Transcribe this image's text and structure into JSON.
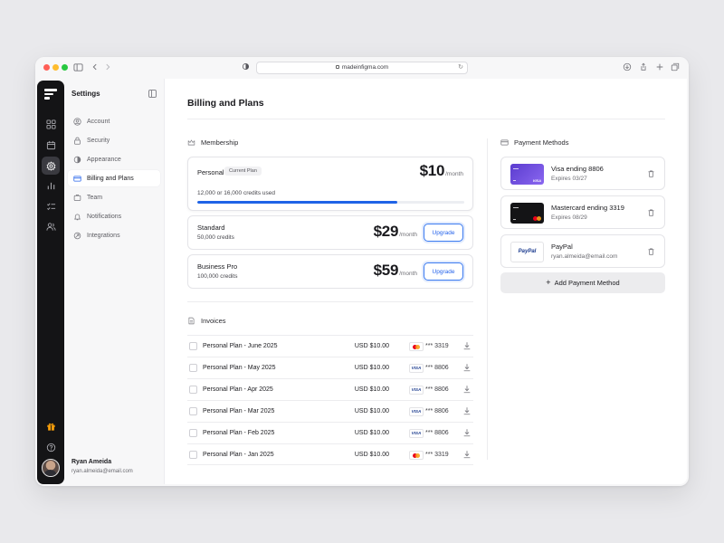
{
  "browser": {
    "url": "madeinfigma.com"
  },
  "colors": {
    "accent": "#1f63e6",
    "rail": "#141416",
    "visa_card": "#6b4ce0",
    "mastercard_card": "#141416"
  },
  "rail": {
    "icons": [
      "logo-icon",
      "grid-icon",
      "calendar-icon",
      "gear-icon",
      "chart-icon",
      "checklist-icon",
      "users-icon",
      "gift-icon",
      "help-icon"
    ],
    "active": "gear-icon"
  },
  "sidebar": {
    "title": "Settings",
    "items": [
      {
        "label": "Account",
        "icon": "user-icon"
      },
      {
        "label": "Security",
        "icon": "lock-icon"
      },
      {
        "label": "Appearance",
        "icon": "contrast-icon"
      },
      {
        "label": "Billing and Plans",
        "icon": "card-icon",
        "active": true
      },
      {
        "label": "Team",
        "icon": "team-icon"
      },
      {
        "label": "Notifications",
        "icon": "bell-icon"
      },
      {
        "label": "Integrations",
        "icon": "integration-icon"
      }
    ],
    "user": {
      "name": "Ryan Ameida",
      "email": "ryan.almeida@email.com"
    }
  },
  "main": {
    "title": "Billing and Plans",
    "membership": {
      "heading": "Membership",
      "plans": [
        {
          "name": "Personal",
          "badge": "Current Plan",
          "price": "$10",
          "period": "/month",
          "usage_text": "12,000 or 16,000 credits used",
          "usage_fraction": 0.75
        },
        {
          "name": "Standard",
          "credits": "50,000 credits",
          "price": "$29",
          "period": "/month",
          "button": "Upgrade"
        },
        {
          "name": "Business Pro",
          "credits": "100,000 credits",
          "price": "$59",
          "period": "/month",
          "button": "Upgrade"
        }
      ]
    },
    "invoices": {
      "heading": "Invoices",
      "rows": [
        {
          "description": "Personal Plan - June 2025",
          "amount": "USD $10.00",
          "brand": "mastercard",
          "card": "*** 3319"
        },
        {
          "description": "Personal Plan - May 2025",
          "amount": "USD $10.00",
          "brand": "visa",
          "brand_label": "VISA",
          "card": "*** 8806"
        },
        {
          "description": "Personal Plan - Apr 2025",
          "amount": "USD $10.00",
          "brand": "visa",
          "brand_label": "VISA",
          "card": "*** 8806"
        },
        {
          "description": "Personal Plan - Mar 2025",
          "amount": "USD $10.00",
          "brand": "visa",
          "brand_label": "VISA",
          "card": "*** 8806"
        },
        {
          "description": "Personal Plan - Feb 2025",
          "amount": "USD $10.00",
          "brand": "visa",
          "brand_label": "VISA",
          "card": "*** 8806"
        },
        {
          "description": "Personal Plan - Jan 2025",
          "amount": "USD $10.00",
          "brand": "mastercard",
          "card": "*** 3319"
        }
      ]
    },
    "payment_methods": {
      "heading": "Payment Methods",
      "methods": [
        {
          "title": "Visa ending 8806",
          "subtitle": "Expires 03/27",
          "kind": "visa",
          "thumb_label": "VISA"
        },
        {
          "title": "Mastercard ending 3319",
          "subtitle": "Expires 08/29",
          "kind": "mastercard"
        },
        {
          "title": "PayPal",
          "subtitle": "ryan.almeida@email.com",
          "kind": "paypal",
          "thumb_label": "PayPal"
        }
      ],
      "add_button": "Add Payment Method"
    }
  }
}
